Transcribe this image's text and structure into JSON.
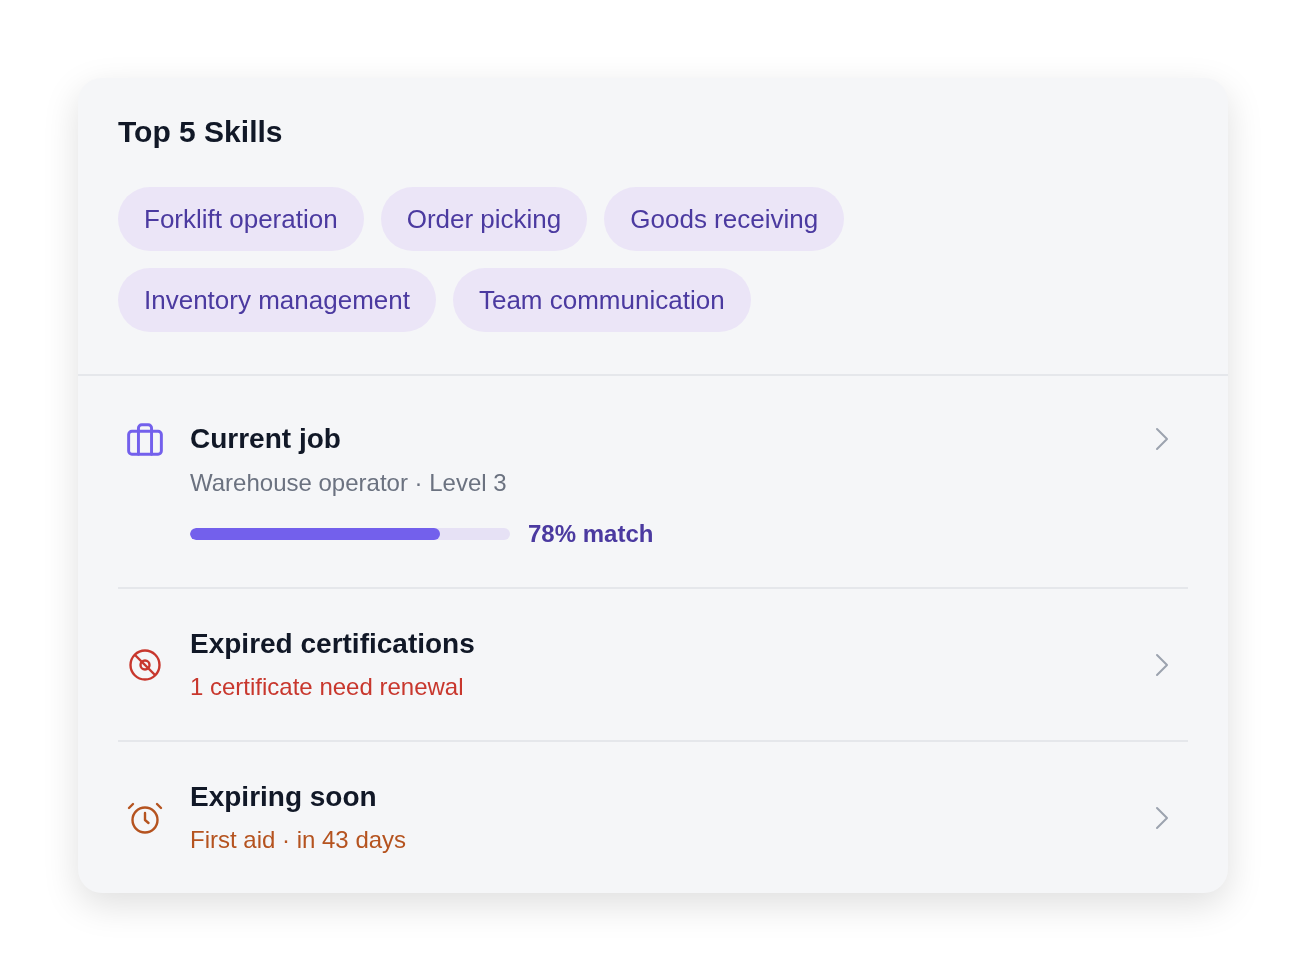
{
  "skills": {
    "title": "Top 5 Skills",
    "chips": [
      "Forklift operation",
      "Order picking",
      "Goods receiving",
      "Inventory management",
      "Team communication"
    ]
  },
  "rows": [
    {
      "kind": "job",
      "title": "Current job",
      "subtitle": "Warehouse operator · Level 3",
      "match": {
        "level": 0.78,
        "label": "78% match"
      }
    },
    {
      "kind": "expired",
      "title": "Expired certifications",
      "subtitle": "1 certificate need renewal"
    },
    {
      "kind": "expiring",
      "title": "Expiring soon",
      "subtitle": "First aid · in 43 days"
    }
  ]
}
